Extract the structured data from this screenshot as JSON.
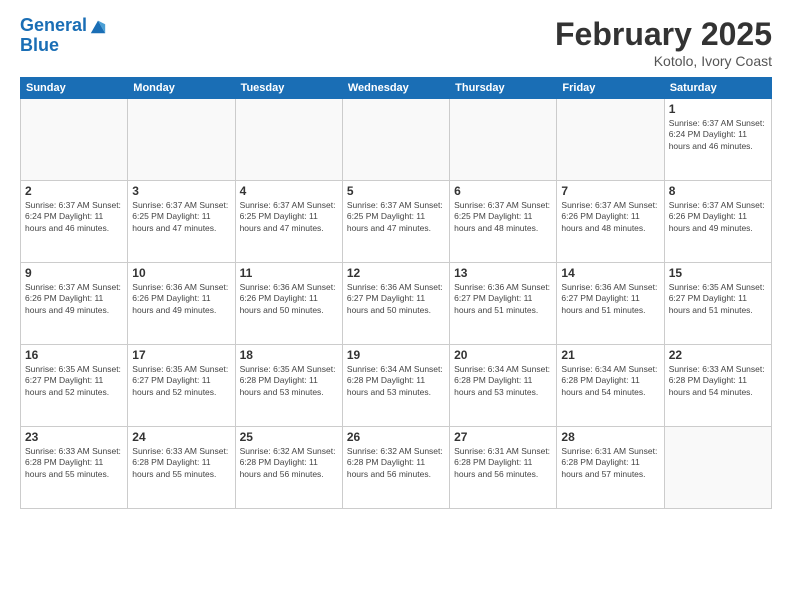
{
  "header": {
    "logo_line1": "General",
    "logo_line2": "Blue",
    "month": "February 2025",
    "location": "Kotolo, Ivory Coast"
  },
  "days_of_week": [
    "Sunday",
    "Monday",
    "Tuesday",
    "Wednesday",
    "Thursday",
    "Friday",
    "Saturday"
  ],
  "weeks": [
    [
      {
        "day": "",
        "info": ""
      },
      {
        "day": "",
        "info": ""
      },
      {
        "day": "",
        "info": ""
      },
      {
        "day": "",
        "info": ""
      },
      {
        "day": "",
        "info": ""
      },
      {
        "day": "",
        "info": ""
      },
      {
        "day": "1",
        "info": "Sunrise: 6:37 AM\nSunset: 6:24 PM\nDaylight: 11 hours\nand 46 minutes."
      }
    ],
    [
      {
        "day": "2",
        "info": "Sunrise: 6:37 AM\nSunset: 6:24 PM\nDaylight: 11 hours\nand 46 minutes."
      },
      {
        "day": "3",
        "info": "Sunrise: 6:37 AM\nSunset: 6:25 PM\nDaylight: 11 hours\nand 47 minutes."
      },
      {
        "day": "4",
        "info": "Sunrise: 6:37 AM\nSunset: 6:25 PM\nDaylight: 11 hours\nand 47 minutes."
      },
      {
        "day": "5",
        "info": "Sunrise: 6:37 AM\nSunset: 6:25 PM\nDaylight: 11 hours\nand 47 minutes."
      },
      {
        "day": "6",
        "info": "Sunrise: 6:37 AM\nSunset: 6:25 PM\nDaylight: 11 hours\nand 48 minutes."
      },
      {
        "day": "7",
        "info": "Sunrise: 6:37 AM\nSunset: 6:26 PM\nDaylight: 11 hours\nand 48 minutes."
      },
      {
        "day": "8",
        "info": "Sunrise: 6:37 AM\nSunset: 6:26 PM\nDaylight: 11 hours\nand 49 minutes."
      }
    ],
    [
      {
        "day": "9",
        "info": "Sunrise: 6:37 AM\nSunset: 6:26 PM\nDaylight: 11 hours\nand 49 minutes."
      },
      {
        "day": "10",
        "info": "Sunrise: 6:36 AM\nSunset: 6:26 PM\nDaylight: 11 hours\nand 49 minutes."
      },
      {
        "day": "11",
        "info": "Sunrise: 6:36 AM\nSunset: 6:26 PM\nDaylight: 11 hours\nand 50 minutes."
      },
      {
        "day": "12",
        "info": "Sunrise: 6:36 AM\nSunset: 6:27 PM\nDaylight: 11 hours\nand 50 minutes."
      },
      {
        "day": "13",
        "info": "Sunrise: 6:36 AM\nSunset: 6:27 PM\nDaylight: 11 hours\nand 51 minutes."
      },
      {
        "day": "14",
        "info": "Sunrise: 6:36 AM\nSunset: 6:27 PM\nDaylight: 11 hours\nand 51 minutes."
      },
      {
        "day": "15",
        "info": "Sunrise: 6:35 AM\nSunset: 6:27 PM\nDaylight: 11 hours\nand 51 minutes."
      }
    ],
    [
      {
        "day": "16",
        "info": "Sunrise: 6:35 AM\nSunset: 6:27 PM\nDaylight: 11 hours\nand 52 minutes."
      },
      {
        "day": "17",
        "info": "Sunrise: 6:35 AM\nSunset: 6:27 PM\nDaylight: 11 hours\nand 52 minutes."
      },
      {
        "day": "18",
        "info": "Sunrise: 6:35 AM\nSunset: 6:28 PM\nDaylight: 11 hours\nand 53 minutes."
      },
      {
        "day": "19",
        "info": "Sunrise: 6:34 AM\nSunset: 6:28 PM\nDaylight: 11 hours\nand 53 minutes."
      },
      {
        "day": "20",
        "info": "Sunrise: 6:34 AM\nSunset: 6:28 PM\nDaylight: 11 hours\nand 53 minutes."
      },
      {
        "day": "21",
        "info": "Sunrise: 6:34 AM\nSunset: 6:28 PM\nDaylight: 11 hours\nand 54 minutes."
      },
      {
        "day": "22",
        "info": "Sunrise: 6:33 AM\nSunset: 6:28 PM\nDaylight: 11 hours\nand 54 minutes."
      }
    ],
    [
      {
        "day": "23",
        "info": "Sunrise: 6:33 AM\nSunset: 6:28 PM\nDaylight: 11 hours\nand 55 minutes."
      },
      {
        "day": "24",
        "info": "Sunrise: 6:33 AM\nSunset: 6:28 PM\nDaylight: 11 hours\nand 55 minutes."
      },
      {
        "day": "25",
        "info": "Sunrise: 6:32 AM\nSunset: 6:28 PM\nDaylight: 11 hours\nand 56 minutes."
      },
      {
        "day": "26",
        "info": "Sunrise: 6:32 AM\nSunset: 6:28 PM\nDaylight: 11 hours\nand 56 minutes."
      },
      {
        "day": "27",
        "info": "Sunrise: 6:31 AM\nSunset: 6:28 PM\nDaylight: 11 hours\nand 56 minutes."
      },
      {
        "day": "28",
        "info": "Sunrise: 6:31 AM\nSunset: 6:28 PM\nDaylight: 11 hours\nand 57 minutes."
      },
      {
        "day": "",
        "info": ""
      }
    ]
  ]
}
